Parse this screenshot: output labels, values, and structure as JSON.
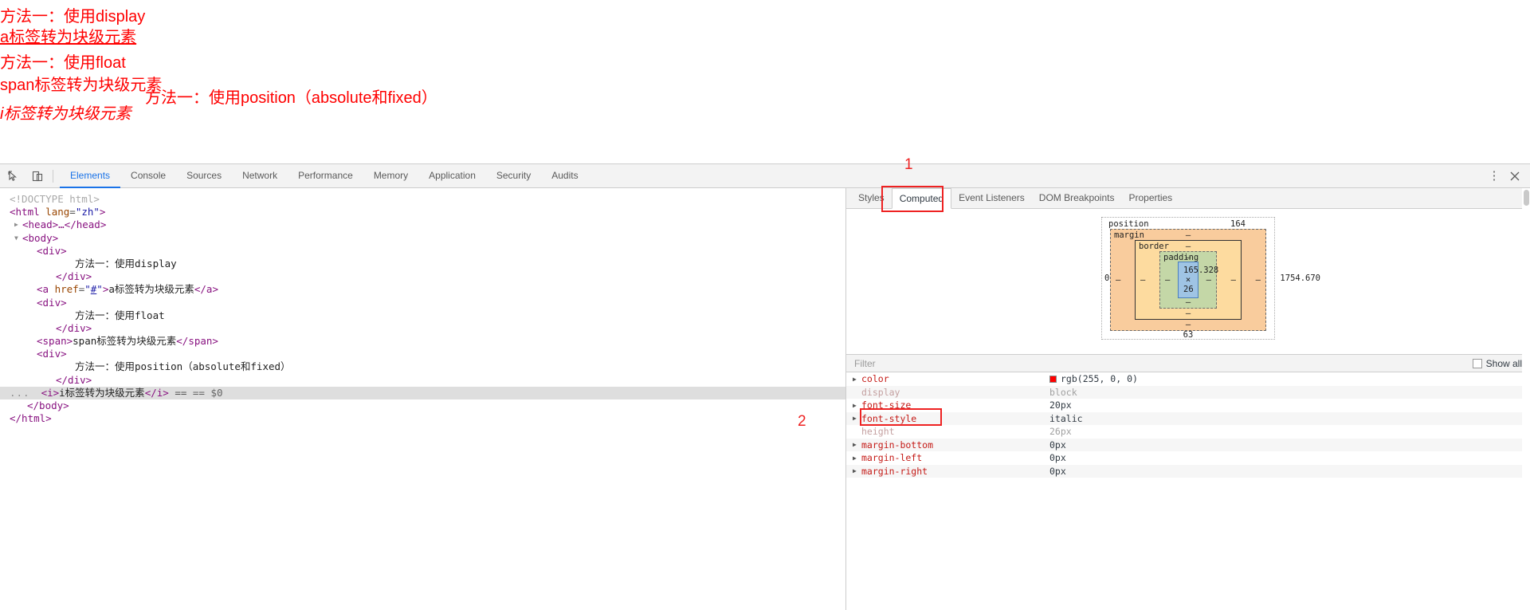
{
  "page": {
    "line_div1": "方法一：使用display",
    "line_a": "a标签转为块级元素",
    "line_div2": "方法一：使用float",
    "line_span": "span标签转为块级元素",
    "line_div3": "方法一：使用position（absolute和fixed）",
    "line_i": "i标签转为块级元素",
    "text_color": "#ff0000"
  },
  "devtools": {
    "toolbar": {
      "inspect_icon": "inspect-cursor-icon",
      "device_icon": "device-toolbar-icon",
      "tabs": [
        {
          "label": "Elements",
          "active": true
        },
        {
          "label": "Console",
          "active": false
        },
        {
          "label": "Sources",
          "active": false
        },
        {
          "label": "Network",
          "active": false
        },
        {
          "label": "Performance",
          "active": false
        },
        {
          "label": "Memory",
          "active": false
        },
        {
          "label": "Application",
          "active": false
        },
        {
          "label": "Security",
          "active": false
        },
        {
          "label": "Audits",
          "active": false
        }
      ],
      "more_icon": "kebab-menu-icon",
      "close_icon": "close-icon",
      "accent_color": "#1a73e8"
    },
    "dom": {
      "lines": [
        {
          "doctype": "<!DOCTYPE html>"
        },
        {
          "tag_open": "<html",
          "attr": "lang",
          "value": "\"zh\"",
          "tag_close": ">"
        },
        {
          "collapsed": "<head>…</head>"
        },
        {
          "tag_open": "<body>"
        },
        {
          "tag_open": "<div>"
        },
        {
          "text": "方法一：使用display"
        },
        {
          "tag_close": "</div>"
        },
        {
          "a_open": "<a href=\"#\">",
          "text": "a标签转为块级元素",
          "a_close": "</a>"
        },
        {
          "tag_open": "<div>"
        },
        {
          "text": "方法一：使用float"
        },
        {
          "tag_close": "</div>"
        },
        {
          "span": "<span>span标签转为块级元素</span>"
        },
        {
          "tag_open": "<div>"
        },
        {
          "text": "方法一：使用position（absolute和fixed）"
        },
        {
          "tag_close": "</div>"
        },
        {
          "selected": "<i>i标签转为块级元素</i> == $0"
        },
        {
          "tag_close": "</body>"
        },
        {
          "tag_close": "</html>"
        }
      ],
      "selected_suffix": "== $0",
      "ellipsis": "..."
    },
    "sidebar": {
      "tabs": [
        {
          "label": "Styles",
          "active": false
        },
        {
          "label": "Computed",
          "active": true
        },
        {
          "label": "Event Listeners",
          "active": false
        },
        {
          "label": "DOM Breakpoints",
          "active": false
        },
        {
          "label": "Properties",
          "active": false
        }
      ],
      "box_model": {
        "position_label": "position",
        "position_value": "164",
        "margin_label": "margin",
        "margin_top": "–",
        "margin_right": "–",
        "margin_bottom": "–",
        "margin_left": "–",
        "border_label": "border",
        "border_top": "–",
        "border_right": "–",
        "border_bottom": "–",
        "border_left": "–",
        "padding_label": "padding",
        "padding_top": "–",
        "padding_right": "–",
        "padding_bottom": "–",
        "padding_left": "–",
        "content_size": "165.328 × 26",
        "outer_left": "0",
        "outer_right": "1754.670",
        "outer_bottom": "63"
      },
      "filter": {
        "placeholder": "Filter",
        "show_all_label": "Show all"
      },
      "properties": [
        {
          "name": "color",
          "value": "rgb(255, 0, 0)",
          "expandable": true,
          "inherited": false,
          "swatch": "#ff0000"
        },
        {
          "name": "display",
          "value": "block",
          "expandable": false,
          "inherited": true,
          "swatch": ""
        },
        {
          "name": "font-size",
          "value": "20px",
          "expandable": true,
          "inherited": false,
          "swatch": ""
        },
        {
          "name": "font-style",
          "value": "italic",
          "expandable": true,
          "inherited": false,
          "swatch": ""
        },
        {
          "name": "height",
          "value": "26px",
          "expandable": false,
          "inherited": true,
          "swatch": ""
        },
        {
          "name": "margin-bottom",
          "value": "0px",
          "expandable": true,
          "inherited": false,
          "swatch": ""
        },
        {
          "name": "margin-left",
          "value": "0px",
          "expandable": true,
          "inherited": false,
          "swatch": ""
        },
        {
          "name": "margin-right",
          "value": "0px",
          "expandable": true,
          "inherited": false,
          "swatch": ""
        }
      ]
    }
  },
  "annotations": [
    {
      "label": "1"
    },
    {
      "label": "2"
    }
  ]
}
